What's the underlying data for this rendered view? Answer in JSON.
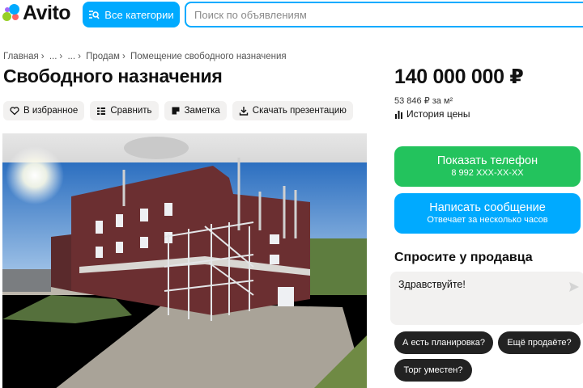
{
  "header": {
    "logo_text": "Avito",
    "categories_label": "Все категории",
    "search_placeholder": "Поиск по объявлениям"
  },
  "breadcrumb": [
    "Главная",
    "...",
    "...",
    "Продам",
    "Помещение свободного назначения"
  ],
  "listing": {
    "title": "Свободного назначения",
    "price": "140 000 000 ₽",
    "price_per_m2": "53 846 ₽ за м²",
    "price_history_label": "История цены"
  },
  "actions": [
    {
      "label": "В избранное",
      "icon": "heart-icon"
    },
    {
      "label": "Сравнить",
      "icon": "compare-icon"
    },
    {
      "label": "Заметка",
      "icon": "note-icon"
    },
    {
      "label": "Скачать презентацию",
      "icon": "download-icon"
    }
  ],
  "contact": {
    "phone_label": "Показать телефон",
    "phone_masked": "8 992 XXX-XX-XX",
    "message_label": "Написать сообщение",
    "message_sub": "Отвечает за несколько часов"
  },
  "ask": {
    "title": "Спросите у продавца",
    "input_value": "Здравствуйте!",
    "chips": [
      "А есть планировка?",
      "Ещё продаёте?",
      "Торг уместен?"
    ]
  },
  "colors": {
    "accent_blue": "#00aaff",
    "accent_green": "#23c35d",
    "chip_dark": "#222222",
    "button_gray": "#f2f1f0"
  }
}
